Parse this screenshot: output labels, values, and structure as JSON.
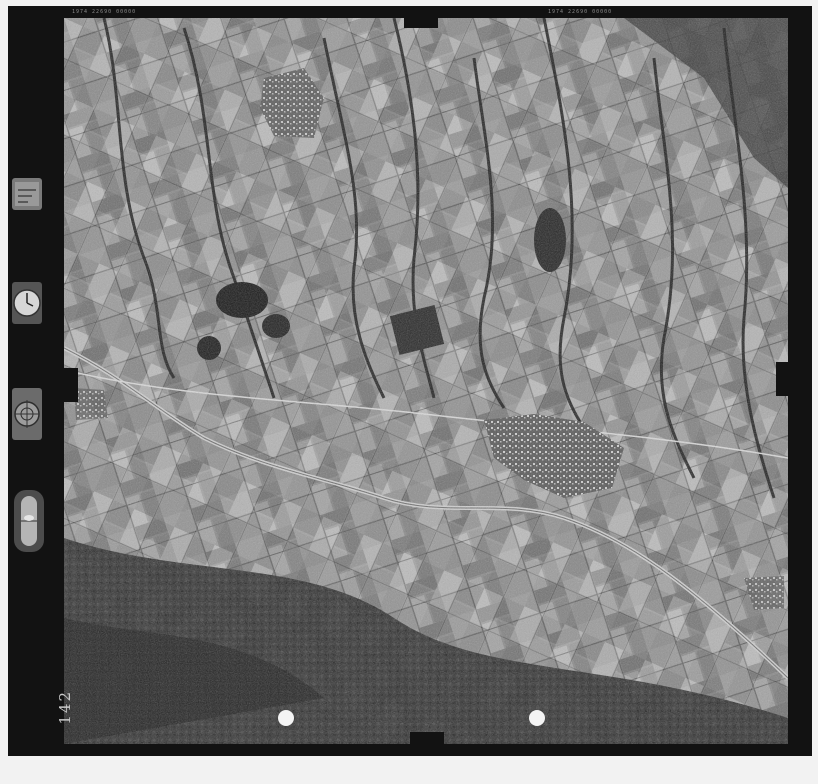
{
  "image": {
    "kind": "aerial-photograph",
    "palette": {
      "frame": "#121212",
      "paper": "#f2f2f2",
      "terrain_dark": "#2a2a2a",
      "terrain_light": "#bdbdbd"
    }
  },
  "frame_codes": {
    "left": "1974 22690 00000",
    "right": "1974 22690 00000"
  },
  "frame_number": "142",
  "instruments": [
    {
      "name": "altimeter-panel-icon"
    },
    {
      "name": "clock-icon"
    },
    {
      "name": "compass-icon"
    },
    {
      "name": "level-bubble-icon"
    }
  ]
}
